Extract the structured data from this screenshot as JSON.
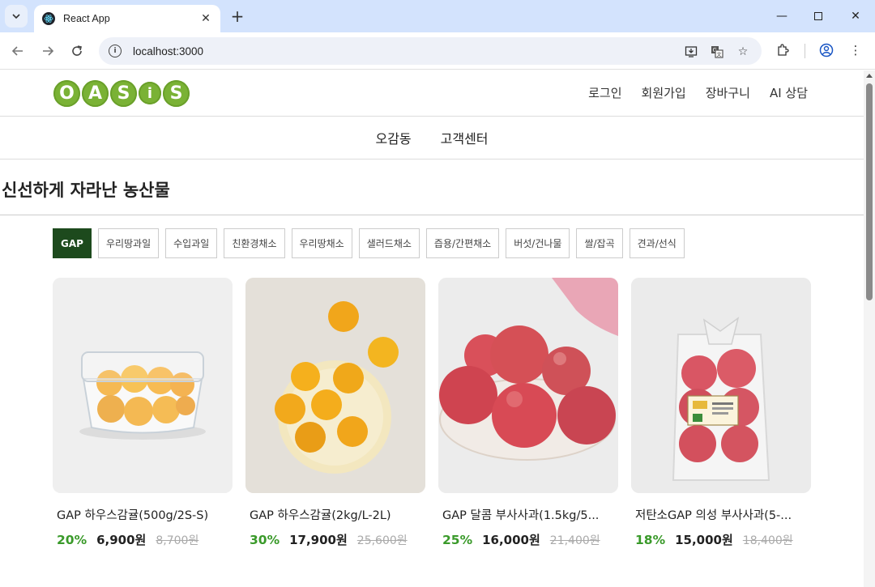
{
  "browser": {
    "tab_title": "React App",
    "url": "localhost:3000"
  },
  "header": {
    "logo_letters": [
      "O",
      "A",
      "S",
      "i",
      "S"
    ],
    "links": [
      "로그인",
      "회원가입",
      "장바구니",
      "AI 상담"
    ]
  },
  "catnav": [
    "오감동",
    "고객센터"
  ],
  "section_title": "신선하게 자라난 농산물",
  "filters": [
    "GAP",
    "우리땅과일",
    "수입과일",
    "친환경채소",
    "우리땅채소",
    "샐러드채소",
    "즙용/간편채소",
    "버섯/건나물",
    "쌀/잡곡",
    "견과/선식"
  ],
  "products": [
    {
      "name": "GAP 하우스감귤(500g/2S-S)",
      "discount": "20%",
      "price": "6,900원",
      "original": "8,700원"
    },
    {
      "name": "GAP 하우스감귤(2kg/L-2L)",
      "discount": "30%",
      "price": "17,900원",
      "original": "25,600원"
    },
    {
      "name": "GAP 달콤 부사사과(1.5kg/5...",
      "discount": "25%",
      "price": "16,000원",
      "original": "21,400원"
    },
    {
      "name": "저탄소GAP 의성 부사사과(5-...",
      "discount": "18%",
      "price": "15,000원",
      "original": "18,400원"
    }
  ],
  "colors": {
    "accent_green": "#3a9a2a",
    "active_chip": "#1d4a1d",
    "logo_green": "#7ab235"
  }
}
